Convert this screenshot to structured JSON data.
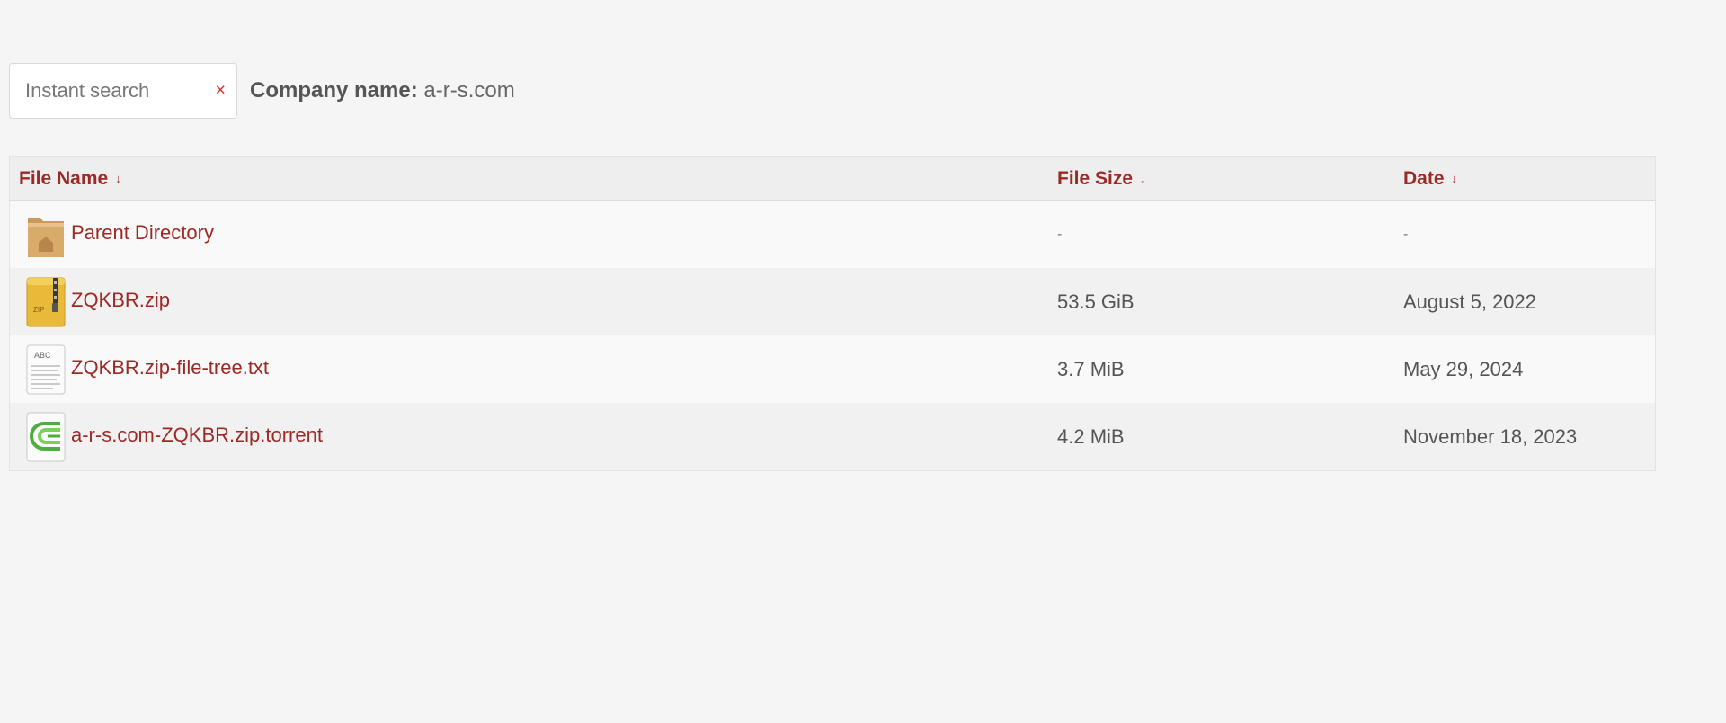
{
  "search": {
    "placeholder": "Instant search",
    "clear_label": "×"
  },
  "company": {
    "label": "Company name:",
    "value": "a-r-s.com"
  },
  "table": {
    "headers": {
      "name": "File Name",
      "size": "File Size",
      "date": "Date",
      "sort_glyph": "↓"
    },
    "rows": [
      {
        "icon": "folder-home-icon",
        "name": "Parent Directory",
        "size": "-",
        "date": "-"
      },
      {
        "icon": "zip-archive-icon",
        "name": "ZQKBR.zip",
        "size": "53.5 GiB",
        "date": "August 5, 2022"
      },
      {
        "icon": "text-file-icon",
        "name": "ZQKBR.zip-file-tree.txt",
        "size": "3.7 MiB",
        "date": "May 29, 2024"
      },
      {
        "icon": "torrent-icon",
        "name": "a-r-s.com-ZQKBR.zip.torrent",
        "size": "4.2 MiB",
        "date": "November 18, 2023"
      }
    ]
  },
  "icons": {
    "zip_badge": "ZIP",
    "txt_badge": "ABC"
  },
  "colors": {
    "link": "#9b2a26",
    "clear": "#d0352e",
    "background": "#f5f5f5"
  }
}
